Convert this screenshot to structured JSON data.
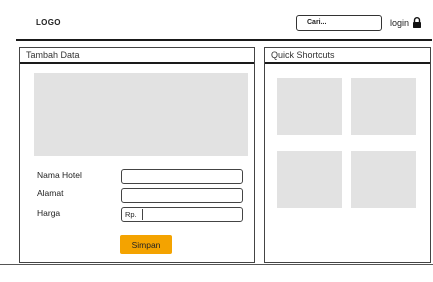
{
  "header": {
    "logo": "LOGO",
    "search_placeholder": "Cari...",
    "login_label": "login"
  },
  "form_panel": {
    "title": "Tambah Data",
    "fields": [
      {
        "label": "Nama Hotel",
        "value": ""
      },
      {
        "label": "Alamat",
        "value": ""
      },
      {
        "label": "Harga",
        "prefix": "Rp.",
        "value": ""
      }
    ],
    "save_label": "Simpan"
  },
  "shortcuts_panel": {
    "title": "Quick Shortcuts"
  },
  "colors": {
    "accent": "#f4a300",
    "placeholder": "#e2e2e2"
  }
}
